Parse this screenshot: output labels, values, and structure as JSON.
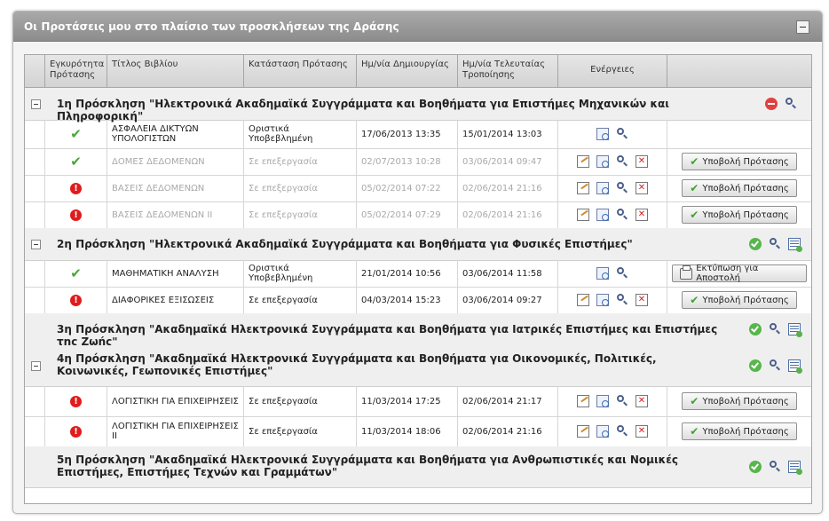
{
  "panel": {
    "title": "Οι Προτάσεις μου στο πλαίσιο των προσκλήσεων της Δράσης"
  },
  "columns": {
    "validity": "Εγκυρότητα Πρότασης",
    "title": "Τίτλος Βιβλίου",
    "status": "Κατάσταση Πρότασης",
    "created": "Ημ/νία Δημιουργίας",
    "modified": "Ημ/νία Τελευταίας Τροποίησης",
    "actions": "Ενέργειες"
  },
  "labels": {
    "submit": "Υποβολή Πρότασης",
    "print": "Εκτύπωση για Αποστολή"
  },
  "groups": [
    {
      "title": "1η Πρόσκληση \"Ηλεκτρονικά Ακαδημαϊκά Συγγράμματα και Βοηθήματα για Επιστήμες Μηχανικών και Πληροφορική\"",
      "rows": [
        {
          "validity": "valid",
          "title": "ΑΣΦΑΛΕΙΑ ΔΙΚΤΥΩΝ ΥΠΟΛΟΓΙΣΤΩΝ",
          "status": "Οριστικά Υποβεβλημένη",
          "created": "17/06/2013 13:35",
          "modified": "15/01/2014 13:03"
        },
        {
          "validity": "valid",
          "title": "ΔΟΜΕΣ ΔΕΔΟΜΕΝΩΝ",
          "status": "Σε επεξεργασία",
          "created": "02/07/2013 10:28",
          "modified": "03/06/2014 09:47"
        },
        {
          "validity": "invalid",
          "title": "ΒΑΣΕΙΣ ΔΕΔΟΜΕΝΩΝ",
          "status": "Σε επεξεργασία",
          "created": "05/02/2014 07:22",
          "modified": "02/06/2014 21:16"
        },
        {
          "validity": "invalid",
          "title": "ΒΑΣΕΙΣ ΔΕΔΟΜΕΝΩΝ ΙΙ",
          "status": "Σε επεξεργασία",
          "created": "05/02/2014 07:29",
          "modified": "02/06/2014 21:16"
        }
      ]
    },
    {
      "title": "2η Πρόσκληση \"Ηλεκτρονικά Ακαδημαϊκά Συγγράμματα και Βοηθήματα για Φυσικές Επιστήμες\"",
      "rows": [
        {
          "validity": "valid",
          "title": "ΜΑΘΗΜΑΤΙΚΗ ΑΝΑΛΥΣΗ",
          "status": "Οριστικά Υποβεβλημένη",
          "created": "21/01/2014 10:56",
          "modified": "03/06/2014 11:58"
        },
        {
          "validity": "invalid",
          "title": "ΔΙΑΦΟΡΙΚΕΣ ΕΞΙΣΩΣΕΙΣ",
          "status": "Σε επεξεργασία",
          "created": "04/03/2014 15:23",
          "modified": "03/06/2014 09:27"
        }
      ]
    },
    {
      "title": "3η Πρόσκληση \"Ακαδημαϊκά Ηλεκτρονικά Συγγράμματα και Βοηθήματα για Ιατρικές Επιστήμες και Επιστήμες της Ζωής\"",
      "rows": []
    },
    {
      "title": "4η Πρόσκληση \"Ακαδημαϊκά Ηλεκτρονικά Συγγράμματα και Βοηθήματα για Οικονομικές, Πολιτικές, Κοινωνικές, Γεωπονικές Επιστήμες\"",
      "rows": [
        {
          "validity": "invalid",
          "title": "ΛΟΓΙΣΤΙΚΗ ΓΙΑ ΕΠΙΧΕΙΡΗΣΕΙΣ",
          "status": "Σε επεξεργασία",
          "created": "11/03/2014 17:25",
          "modified": "02/06/2014 21:17"
        },
        {
          "validity": "invalid",
          "title": "ΛΟΓΙΣΤΙΚΗ ΓΙΑ ΕΠΙΧΕΙΡΗΣΕΙΣ ΙΙ",
          "status": "Σε επεξεργασία",
          "created": "11/03/2014 18:06",
          "modified": "02/06/2014 21:16"
        }
      ]
    },
    {
      "title": "5η Πρόσκληση \"Ακαδημαϊκά Ηλεκτρονικά Συγγράμματα και Βοηθήματα για Ανθρωπιστικές και Νομικές Επιστήμες, Επιστήμες Τεχνών και Γραμμάτων\"",
      "rows": []
    }
  ]
}
